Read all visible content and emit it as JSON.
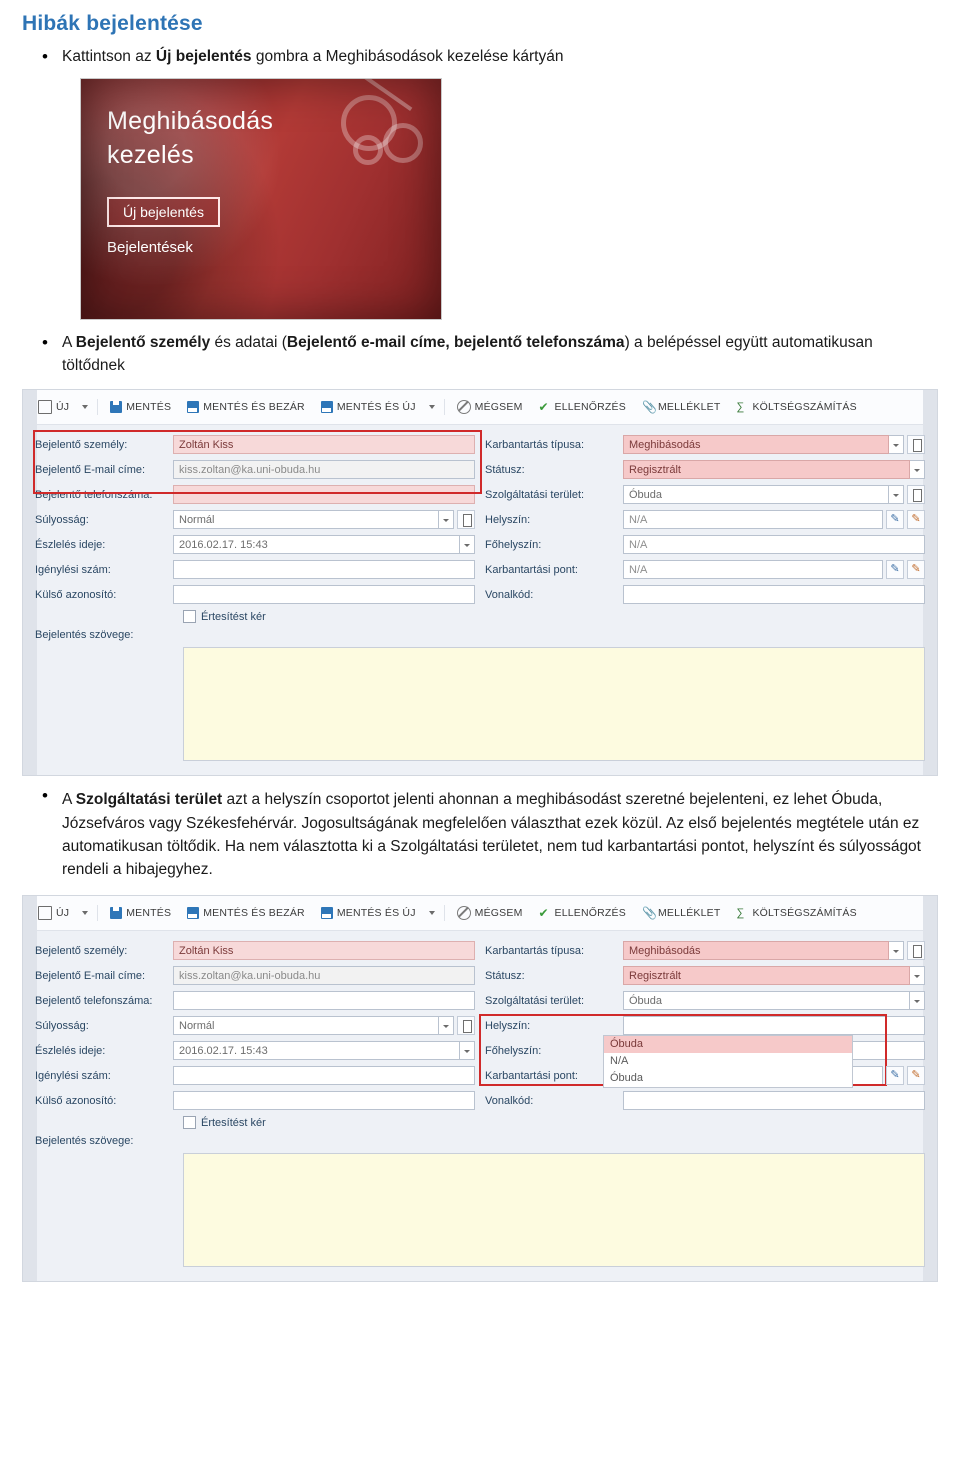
{
  "document": {
    "title": "Hibák bejelentése",
    "bullet1": {
      "prefix": "Kattintson az ",
      "bold": "Új bejelentés",
      "suffix": " gombra a Meghibásodások kezelése kártyán"
    },
    "bullet2": {
      "part1": "A ",
      "bold1": "Bejelentő személy",
      "part2": " és adatai (",
      "bold2": "Bejelentő e-mail címe, bejelentő telefonszáma",
      "part3": ") a belépéssel együtt automatikusan töltődnek"
    },
    "bullet3": {
      "part1": "A ",
      "bold1": "Szolgáltatási terület",
      "part2": " azt a helyszín csoportot jelenti ahonnan a meghibásodást szeretné bejelenteni, ez lehet Óbuda, Józsefváros vagy Székesfehérvár. Jogosultságának megfelelően választhat ezek közül. Az első bejelentés megtétele után ez automatikusan töltődik. Ha nem választotta ki a Szolgáltatási területet, nem tud karbantartási pontot, helyszínt és súlyosságot rendeli a hibajegyhez."
    }
  },
  "card_screenshot": {
    "title_line1": "Meghibásodás",
    "title_line2": "kezelés",
    "new_report_button": "Új bejelentés",
    "reports_link": "Bejelentések"
  },
  "form": {
    "ribbon": [
      {
        "label": "ÚJ",
        "icon": "new-doc-icon",
        "caret": true
      },
      {
        "label": "MENTÉS",
        "icon": "save-icon",
        "caret": false
      },
      {
        "label": "MENTÉS ÉS BEZÁR",
        "icon": "save-close-icon",
        "caret": false
      },
      {
        "label": "MENTÉS ÉS ÚJ",
        "icon": "save-new-icon",
        "caret": true
      },
      {
        "label": "MÉGSEM",
        "icon": "cancel-icon",
        "caret": false
      },
      {
        "label": "ELLENŐRZÉS",
        "icon": "check-icon",
        "caret": false
      },
      {
        "label": "MELLÉKLET",
        "icon": "paperclip-icon",
        "caret": false
      },
      {
        "label": "KÖLTSÉGSZÁMÍTÁS",
        "icon": "calculator-icon",
        "caret": false
      }
    ],
    "labels": {
      "reporter": "Bejelentő személy:",
      "email": "Bejelentő E-mail címe:",
      "phone": "Bejelentő telefonszáma:",
      "severity": "Súlyosság:",
      "detected": "Észlelés ideje:",
      "claim_no": "Igénylési szám:",
      "external_id": "Külső azonosító:",
      "notify": "Értesítést kér",
      "report_text": "Bejelentés szövege:",
      "maintenance_type": "Karbantartás típusa:",
      "status": "Státusz:",
      "service_area": "Szolgáltatási terület:",
      "location": "Helyszín:",
      "main_location": "Főhelyszín:",
      "maintenance_point": "Karbantartási pont:",
      "barcode": "Vonalkód:"
    },
    "values": {
      "reporter": "Zoltán Kiss",
      "email": "kiss.zoltan@ka.uni-obuda.hu",
      "phone": "",
      "severity": "Normál",
      "detected": "2016.02.17. 15:43",
      "claim_no": "",
      "external_id": "",
      "report_text": "",
      "maintenance_type": "Meghibásodás",
      "status": "Regisztrált",
      "service_area": "Óbuda",
      "location": "N/A",
      "main_location": "N/A",
      "maintenance_point": "N/A",
      "barcode": ""
    },
    "dropdown_options": [
      "N/A",
      "Óbuda"
    ]
  },
  "colors": {
    "title": "#2e74b5",
    "highlight_box": "#d02a2a",
    "field_red": "#f6c9c9",
    "textarea_yellow": "#fdfbe0"
  }
}
